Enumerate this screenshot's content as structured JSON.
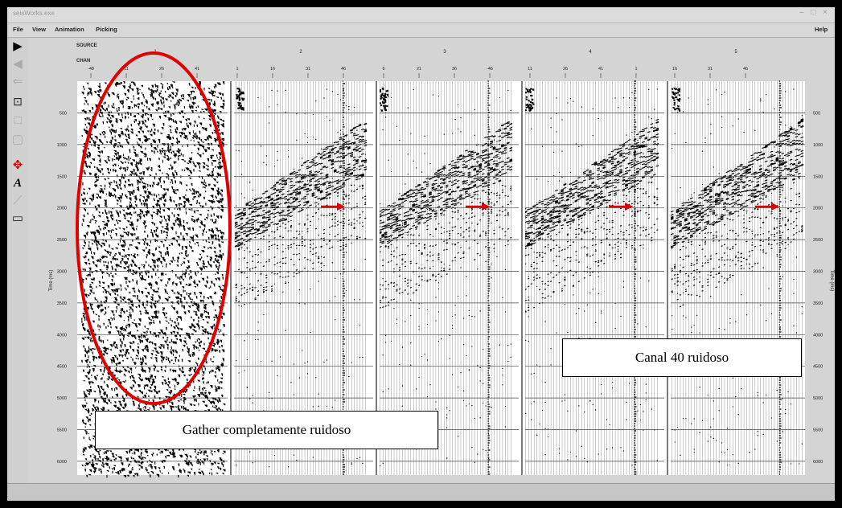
{
  "window": {
    "title": "seisWorks.exe",
    "controls": "– □ ×"
  },
  "menu": {
    "file": "File",
    "view": "View",
    "animation": "Animation",
    "picking": "Picking",
    "help": "Help"
  },
  "header_labels": {
    "source": "SOURCE",
    "chan": "CHAN"
  },
  "source_labels": [
    "1",
    "2",
    "3",
    "4",
    "5"
  ],
  "chan_ticks": [
    "-48",
    "11",
    "26",
    "41",
    "1",
    "16",
    "31",
    "46",
    "6",
    "21",
    "36",
    "-46",
    "11",
    "26",
    "41",
    "1",
    "16",
    "31",
    "46"
  ],
  "time_ticks": [
    "500",
    "1000",
    "1500",
    "2000",
    "2500",
    "3000",
    "3500",
    "4000",
    "4500",
    "5000",
    "5500",
    "6000"
  ],
  "axis_label_left": "Time (ms)",
  "axis_label_right": "Time (ms)",
  "annotations": {
    "gather_noisy": "Gather completamente ruidoso",
    "channel_noisy": "Canal 40 ruidoso"
  },
  "colors": {
    "annotation_red": "#e00000",
    "trace_black": "#000000",
    "grid_line": "#444444",
    "panel_background": "#ffffff"
  },
  "toolbar_icons": [
    "play-icon",
    "step-back-icon",
    "step-forward-icon",
    "zoom-icon",
    "pan-icon",
    "select-icon",
    "move-icon",
    "text-tool-icon",
    "line-tool-icon",
    "frame-icon"
  ]
}
